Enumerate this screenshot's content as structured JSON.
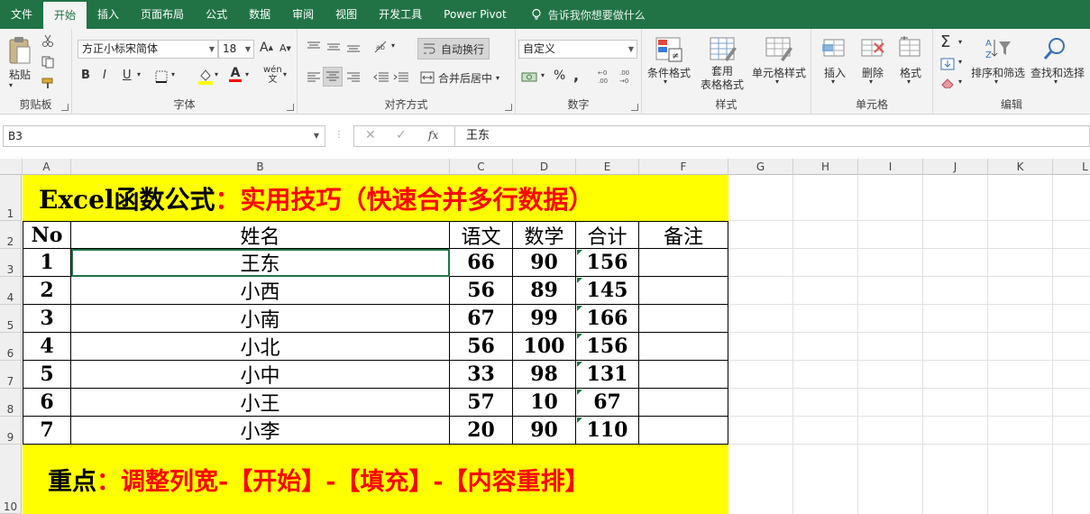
{
  "menu": {
    "tabs": [
      "文件",
      "开始",
      "插入",
      "页面布局",
      "公式",
      "数据",
      "审阅",
      "视图",
      "开发工具",
      "Power Pivot"
    ],
    "active": "开始",
    "tell_me": "告诉我你想要做什么"
  },
  "ribbon": {
    "clipboard": {
      "label": "剪贴板",
      "paste": "粘贴"
    },
    "font": {
      "label": "字体",
      "font_name": "方正小标宋简体",
      "font_size": "18",
      "bold": "B",
      "italic": "I",
      "underline": "U",
      "font_color_glyph": "A",
      "wen": "wén\n文"
    },
    "alignment": {
      "label": "对齐方式",
      "wrap_text": "自动换行",
      "merge_center": "合并后居中"
    },
    "number": {
      "label": "数字",
      "format": "自定义",
      "percent": "%",
      "comma": ","
    },
    "styles": {
      "label": "样式",
      "conditional": "条件格式",
      "table": "套用\n表格格式",
      "cell_styles": "单元格样式"
    },
    "cells": {
      "label": "单元格",
      "insert": "插入",
      "delete": "删除",
      "format": "格式"
    },
    "editing": {
      "label": "编辑",
      "sort_filter": "排序和筛选",
      "find_select": "查找和选择"
    }
  },
  "formula_bar": {
    "name_box": "B3",
    "fx": "fx",
    "value": "王东"
  },
  "columns": [
    "A",
    "B",
    "C",
    "D",
    "E",
    "F",
    "G",
    "H",
    "I",
    "J",
    "K",
    "L"
  ],
  "rows": [
    "1",
    "2",
    "3",
    "4",
    "5",
    "6",
    "7",
    "8",
    "9",
    "10"
  ],
  "sheet": {
    "title_black": "Excel函数公式",
    "title_red": "：实用技巧（快速合并多行数据）",
    "headers": [
      "No",
      "姓名",
      "语文",
      "数学",
      "合计",
      "备注"
    ],
    "data": [
      [
        "1",
        "王东",
        "66",
        "90",
        "156",
        ""
      ],
      [
        "2",
        "小西",
        "56",
        "89",
        "145",
        ""
      ],
      [
        "3",
        "小南",
        "67",
        "99",
        "166",
        ""
      ],
      [
        "4",
        "小北",
        "56",
        "100",
        "156",
        ""
      ],
      [
        "5",
        "小中",
        "33",
        "98",
        "131",
        ""
      ],
      [
        "6",
        "小王",
        "57",
        "10",
        "67",
        ""
      ],
      [
        "7",
        "小李",
        "20",
        "90",
        "110",
        ""
      ]
    ],
    "footer_black": "重点",
    "footer_red": "：调整列宽-【开始】-【填充】-【内容重排】",
    "highlight_color": "#ffff00",
    "red_color": "#ff0000",
    "accent_color": "#217346"
  }
}
